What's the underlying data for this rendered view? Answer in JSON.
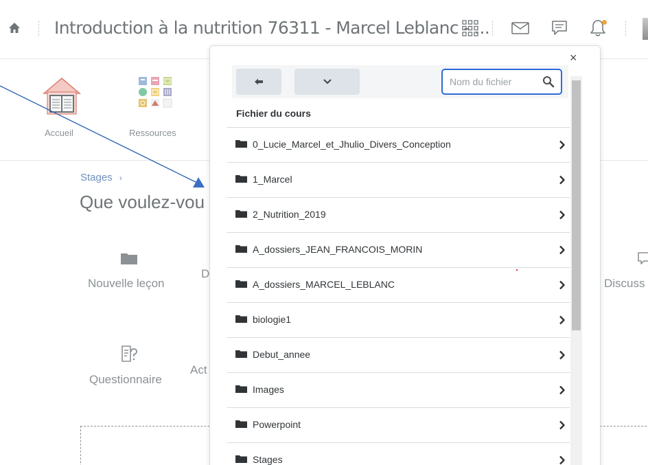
{
  "header": {
    "course_title": "Introduction à la nutrition 76311 - Marcel Leblanc - ..."
  },
  "nav": {
    "items": [
      {
        "label": "Accueil",
        "icon": "house-books-icon"
      },
      {
        "label": "Ressources",
        "icon": "resources-grid-icon"
      }
    ]
  },
  "content": {
    "breadcrumb": "Stages",
    "breadcrumb_sep": "›",
    "heading": "Que voulez-vou",
    "tiles": {
      "new_lesson": "Nouvelle leçon",
      "d_partial": "D",
      "quiz": "Questionnaire",
      "act_partial": "Act",
      "discussion_partial": "Discuss"
    }
  },
  "file_picker": {
    "search_placeholder": "Nom du fichier",
    "section_title": "Fichier du cours",
    "close": "×",
    "back_icon": "back-arrow-icon",
    "dropdown_icon": "chevron-down-icon",
    "folders": [
      {
        "name": "0_Lucie_Marcel_et_Jhulio_Divers_Conception"
      },
      {
        "name": "1_Marcel"
      },
      {
        "name": "2_Nutrition_2019"
      },
      {
        "name": "A_dossiers_JEAN_FRANCOIS_MORIN"
      },
      {
        "name": "A_dossiers_MARCEL_LEBLANC"
      },
      {
        "name": "biologie1"
      },
      {
        "name": "Debut_annee"
      },
      {
        "name": "Images"
      },
      {
        "name": "Powerpoint"
      },
      {
        "name": "Stages"
      }
    ]
  },
  "colors": {
    "accent": "#2b6bd8",
    "notification": "#f0a33c",
    "arrow": "#2b5fb8",
    "link": "#6d8fbf"
  }
}
